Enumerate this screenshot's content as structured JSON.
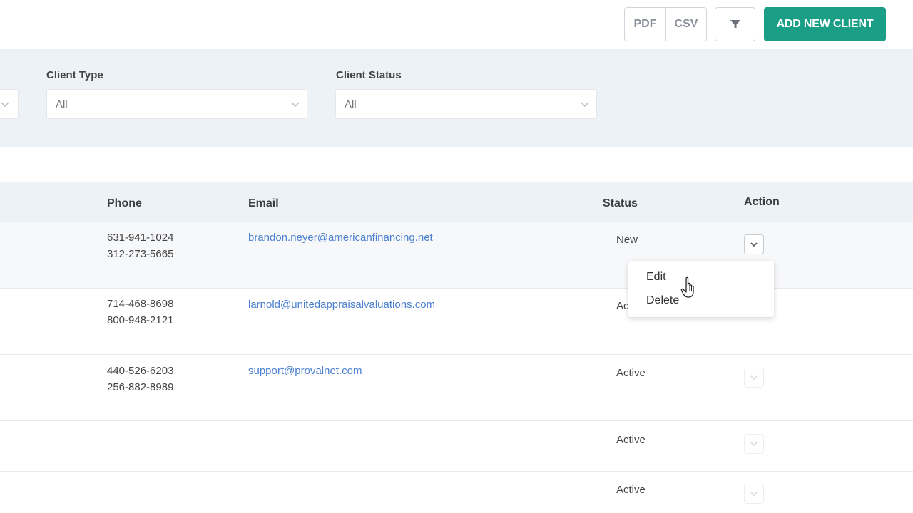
{
  "toolbar": {
    "pdf_label": "PDF",
    "csv_label": "CSV",
    "filter_icon": "filter-icon",
    "add_client_label": "ADD NEW CLIENT",
    "accent_color": "#1a9e86"
  },
  "filters": {
    "client_type": {
      "label": "Client Type",
      "value": "All"
    },
    "client_status": {
      "label": "Client Status",
      "value": "All"
    }
  },
  "table": {
    "columns": {
      "phone": "Phone",
      "email": "Email",
      "status": "Status",
      "action": "Action"
    },
    "rows": [
      {
        "phone1": "631-941-1024",
        "phone2": "312-273-5665",
        "email": "brandon.neyer@americanfinancing.net",
        "status": "New"
      },
      {
        "phone1": "714-468-8698",
        "phone2": "800-948-2121",
        "email": "larnold@unitedappraisalvaluations.com",
        "status": "Ac"
      },
      {
        "phone1": "440-526-6203",
        "phone2": "256-882-8989",
        "email": "support@provalnet.com",
        "status": "Active"
      },
      {
        "phone1": "",
        "phone2": "",
        "email": "",
        "status": "Active"
      },
      {
        "phone1": "",
        "phone2": "",
        "email": "",
        "status": "Active"
      }
    ]
  },
  "action_menu": {
    "edit_label": "Edit",
    "delete_label": "Delete"
  }
}
